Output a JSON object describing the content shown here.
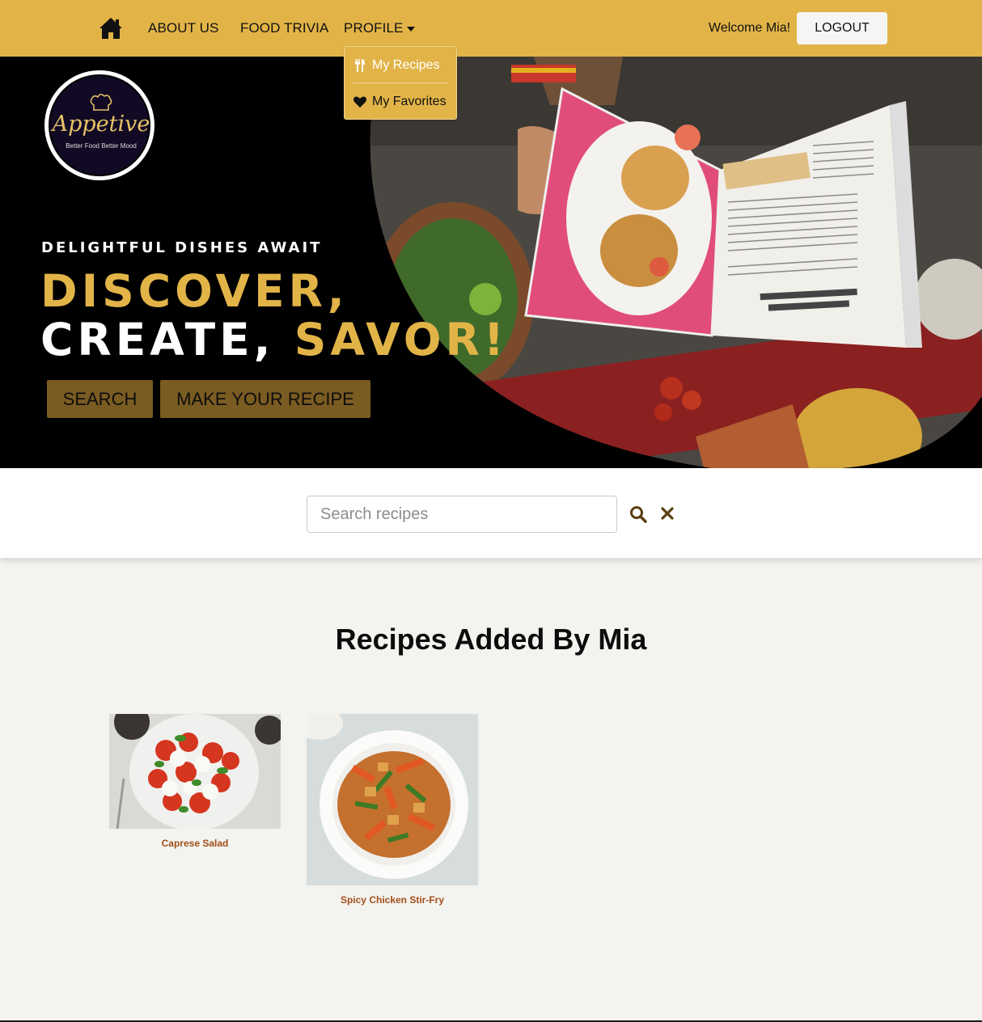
{
  "nav": {
    "home_icon": "home-icon",
    "about": "ABOUT US",
    "trivia": "FOOD TRIVIA",
    "profile": "PROFILE",
    "welcome": "Welcome Mia!",
    "logout": "LOGOUT"
  },
  "dropdown": {
    "items": [
      {
        "label": "My Recipes",
        "icon": "utensils-icon"
      },
      {
        "label": "My Favorites",
        "icon": "heart-icon"
      }
    ]
  },
  "hero": {
    "logo_text": "Appetive",
    "logo_tagline": "Better Food Better Mood",
    "eyebrow": "DELIGHTFUL DISHES AWAIT",
    "headline_1": "DISCOVER,",
    "headline_2a": "CREATE, ",
    "headline_2b": "SAVOR!",
    "search_btn": "SEARCH",
    "make_btn": "MAKE YOUR RECIPE"
  },
  "search": {
    "placeholder": "Search recipes",
    "value": ""
  },
  "section": {
    "title": "Recipes Added By Mia"
  },
  "recipes": [
    {
      "title": "Caprese Salad"
    },
    {
      "title": "Spicy Chicken Stir-Fry"
    }
  ],
  "colors": {
    "brand": "#e2b448",
    "hero_button": "#7a5b21",
    "recipe_title": "#a14f19",
    "page_bg": "#f3f3ef"
  }
}
